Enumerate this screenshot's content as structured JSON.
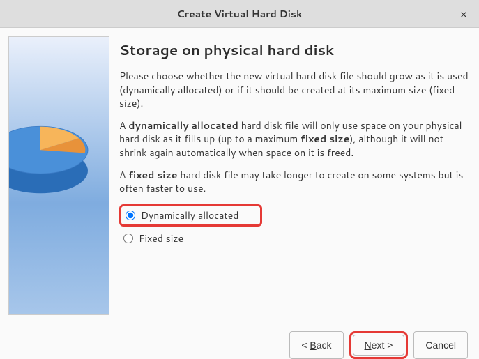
{
  "window": {
    "title": "Create Virtual Hard Disk",
    "close": "×"
  },
  "page": {
    "heading": "Storage on physical hard disk",
    "p1": "Please choose whether the new virtual hard disk file should grow as it is used (dynamically allocated) or if it should be created at its maximum size (fixed size).",
    "p2_a": "A ",
    "p2_b": "dynamically allocated",
    "p2_c": " hard disk file will only use space on your physical hard disk as it fills up (up to a maximum ",
    "p2_d": "fixed size",
    "p2_e": "), although it will not shrink again automatically when space on it is freed.",
    "p3_a": "A ",
    "p3_b": "fixed size",
    "p3_c": " hard disk file may take longer to create on some systems but is often faster to use."
  },
  "options": {
    "dynamic_u": "D",
    "dynamic_rest": "ynamically allocated",
    "fixed_u": "F",
    "fixed_rest": "ixed size"
  },
  "buttons": {
    "back_lt": "< ",
    "back_u": "B",
    "back_rest": "ack",
    "next_u": "N",
    "next_rest": "ext >",
    "cancel": "Cancel"
  }
}
